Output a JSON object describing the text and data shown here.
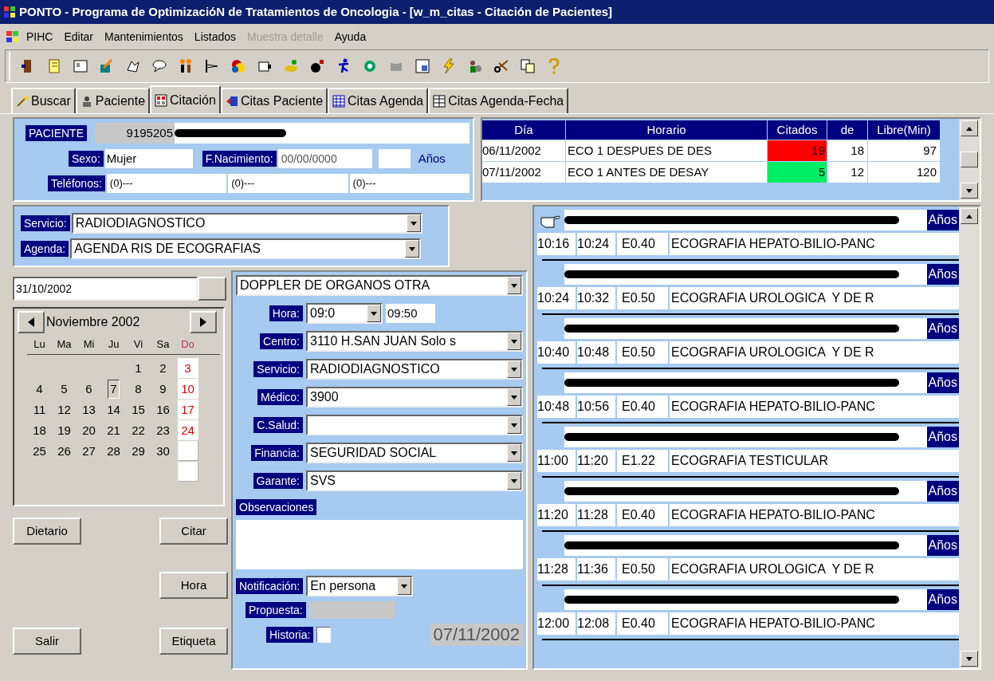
{
  "window": {
    "title": "PONTO - Programa de OptimizacióN de Tratamientos de Oncologia - [w_m_citas - Citación de Pacientes]"
  },
  "menu": [
    {
      "label": "PIHC",
      "disabled": false
    },
    {
      "label": "Editar",
      "disabled": false
    },
    {
      "label": "Mantenimientos",
      "disabled": false
    },
    {
      "label": "Listados",
      "disabled": false
    },
    {
      "label": "Muestra detalle",
      "disabled": true
    },
    {
      "label": "Ayuda",
      "disabled": false
    }
  ],
  "tabs": [
    {
      "label": "Buscar",
      "selected": false
    },
    {
      "label": "Paciente",
      "selected": false
    },
    {
      "label": "Citación",
      "selected": true
    },
    {
      "label": "Citas Paciente",
      "selected": false
    },
    {
      "label": "Citas Agenda",
      "selected": false
    },
    {
      "label": "Citas Agenda-Fecha",
      "selected": false
    }
  ],
  "patient": {
    "label": "PACIENTE",
    "number": "9195205",
    "sexo_label": "Sexo:",
    "sexo": "Mujer",
    "fnac_label": "F.Nacimiento:",
    "fnac": "00/00/0000",
    "anos": "Años",
    "telefonos_label": "Teléfonos:",
    "phones": [
      "(0)---",
      "(0)---",
      "(0)---"
    ]
  },
  "schedule": {
    "columns": [
      "Día",
      "Horario",
      "Citados",
      "de",
      "Libre(Min)"
    ],
    "rows": [
      {
        "dia": "06/11/2002",
        "horario": "ECO 1 DESPUES DE DES",
        "citados": "19",
        "color": "#ff0000",
        "de": "18",
        "libre": "97"
      },
      {
        "dia": "07/11/2002",
        "horario": "ECO 1 ANTES DE DESAY",
        "citados": "5",
        "color": "#00ee66",
        "de": "12",
        "libre": "120"
      }
    ]
  },
  "service": {
    "servicio_label": "Servicio:",
    "servicio": "RADIODIAGNOSTICO",
    "agenda_label": "Agenda:",
    "agenda": "AGENDA RIS DE ECOGRAFIAS"
  },
  "calendar": {
    "date_field": "31/10/2002",
    "month": "Noviembre 2002",
    "weekdays": [
      "Lu",
      "Ma",
      "Mi",
      "Ju",
      "Vi",
      "Sa",
      "Do"
    ],
    "weeks": [
      {
        "kind": "first",
        "days": [
          {
            "day": "1",
            "selected": false
          },
          {
            "day": "2",
            "selected": false
          },
          {
            "day": "3",
            "selected": false
          }
        ]
      },
      {
        "kind": "full",
        "days": [
          {
            "day": "4",
            "selected": false
          },
          {
            "day": "5",
            "selected": false
          },
          {
            "day": "6",
            "selected": false
          },
          {
            "day": "7",
            "selected": true
          },
          {
            "day": "8",
            "selected": false
          },
          {
            "day": "9",
            "selected": false
          },
          {
            "day": "10",
            "selected": false
          }
        ]
      },
      {
        "kind": "full",
        "days": [
          {
            "day": "11",
            "selected": false
          },
          {
            "day": "12",
            "selected": false
          },
          {
            "day": "13",
            "selected": false
          },
          {
            "day": "14",
            "selected": false
          },
          {
            "day": "15",
            "selected": false
          },
          {
            "day": "16",
            "selected": false
          },
          {
            "day": "17",
            "selected": false
          }
        ]
      },
      {
        "kind": "full",
        "days": [
          {
            "day": "18",
            "selected": false
          },
          {
            "day": "19",
            "selected": false
          },
          {
            "day": "20",
            "selected": false
          },
          {
            "day": "21",
            "selected": false
          },
          {
            "day": "22",
            "selected": false
          },
          {
            "day": "23",
            "selected": false
          },
          {
            "day": "24",
            "selected": false
          }
        ]
      },
      {
        "kind": "full",
        "days": [
          {
            "day": "25",
            "selected": false
          },
          {
            "day": "26",
            "selected": false
          },
          {
            "day": "27",
            "selected": false
          },
          {
            "day": "28",
            "selected": false
          },
          {
            "day": "29",
            "selected": false
          },
          {
            "day": "30",
            "selected": false
          },
          {
            "kind": "blank"
          }
        ]
      },
      {
        "kind": "first",
        "days": [
          {
            "kind": "blank"
          }
        ]
      }
    ]
  },
  "buttons": [
    {
      "label": "Dietario"
    },
    {
      "label": "Citar"
    },
    {
      "label": "Hora"
    },
    {
      "label": "Salir"
    },
    {
      "label": "Etiqueta"
    }
  ],
  "form": {
    "prestacion": "DOPPLER DE ORGANOS OTRA",
    "fields": [
      {
        "kind": "time",
        "label": "Hora:",
        "value": "09:0",
        "extra": "09:50"
      },
      {
        "kind": "select",
        "label": "Centro:",
        "value": "3110 H.SAN JUAN Solo s"
      },
      {
        "kind": "select",
        "label": "Servicio:",
        "value": "RADIODIAGNOSTICO"
      },
      {
        "kind": "select",
        "label": "Médico:",
        "value": "3900"
      },
      {
        "kind": "select",
        "label": "C.Salud:"
      },
      {
        "kind": "select",
        "label": "Financia:",
        "value": "SEGURIDAD SOCIAL"
      },
      {
        "kind": "select",
        "label": "Garante:",
        "value": "SVS"
      }
    ],
    "observaciones_label": "Observaciones",
    "notificacion_label": "Notificación:",
    "notificacion": "En persona",
    "propuesta_label": "Propuesta:",
    "historia_label": "Historia:",
    "historia_checked": false,
    "date": "07/11/2002"
  },
  "appointments": [
    {
      "pointer": true,
      "anos": "Años",
      "inicio": "10:16",
      "fin": "10:24",
      "code": "E0.40",
      "desc": "ECOGRAFIA HEPATO-BILIO-PANC"
    },
    {
      "pointer": false,
      "anos": "Años",
      "inicio": "10:24",
      "fin": "10:32",
      "code": "E0.50",
      "desc": "ECOGRAFIA UROLOGICA  Y DE R"
    },
    {
      "pointer": false,
      "anos": "Años",
      "inicio": "10:40",
      "fin": "10:48",
      "code": "E0.50",
      "desc": "ECOGRAFIA UROLOGICA  Y DE R"
    },
    {
      "pointer": false,
      "anos": "Años",
      "inicio": "10:48",
      "fin": "10:56",
      "code": "E0.40",
      "desc": "ECOGRAFIA HEPATO-BILIO-PANC"
    },
    {
      "pointer": false,
      "anos": "Años",
      "inicio": "11:00",
      "fin": "11:20",
      "code": "E1.22",
      "desc": "ECOGRAFIA TESTICULAR"
    },
    {
      "pointer": false,
      "anos": "Años",
      "inicio": "11:20",
      "fin": "11:28",
      "code": "E0.40",
      "desc": "ECOGRAFIA HEPATO-BILIO-PANC"
    },
    {
      "pointer": false,
      "anos": "Años",
      "inicio": "11:28",
      "fin": "11:36",
      "code": "E0.50",
      "desc": "ECOGRAFIA UROLOGICA  Y DE R"
    },
    {
      "pointer": false,
      "anos": "Años",
      "inicio": "12:00",
      "fin": "12:08",
      "code": "E0.40",
      "desc": "ECOGRAFIA HEPATO-BILIO-PANC"
    }
  ]
}
